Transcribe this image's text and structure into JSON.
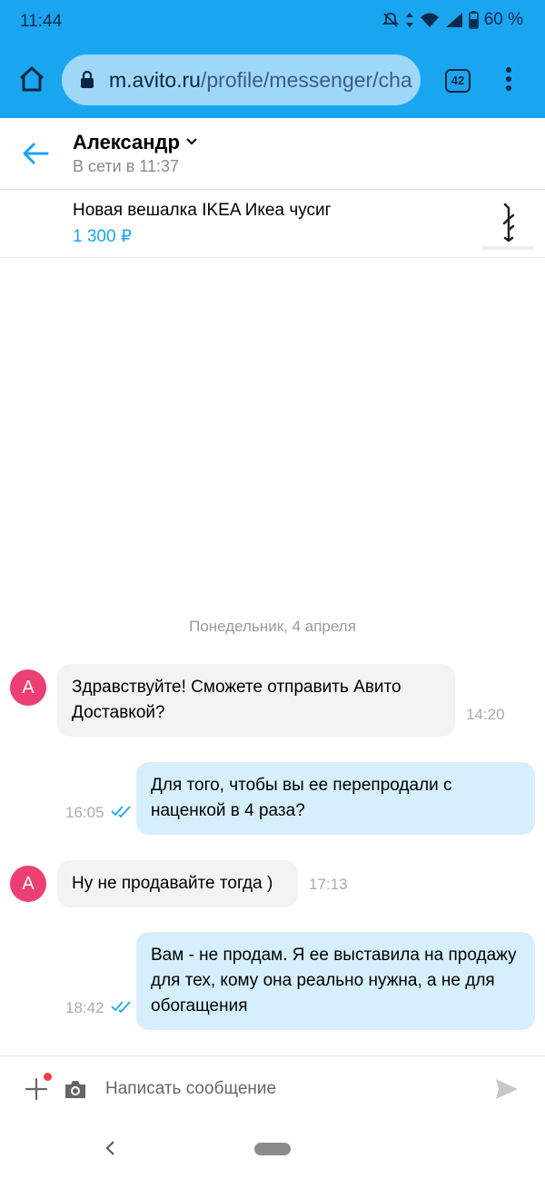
{
  "status_bar": {
    "time": "11:44",
    "battery": "60 %"
  },
  "browser": {
    "url_host": "m.avito.ru",
    "url_path": "/profile/messenger/cha",
    "tab_count": "42"
  },
  "chat": {
    "contact_name": "Александр",
    "contact_status": "В сети в 11:37",
    "avatar_letter": "А",
    "item": {
      "title": "Новая вешалка IKEA Икеа чусиг",
      "price": "1 300 ₽"
    },
    "date_separator": "Понедельник, 4 апреля",
    "messages": [
      {
        "direction": "in",
        "text": "Здравствуйте! Сможете отправить Авито Доставкой?",
        "time": "14:20"
      },
      {
        "direction": "out",
        "text": "Для того, чтобы вы ее перепродали с наценкой в 4 раза?",
        "time": "16:05"
      },
      {
        "direction": "in",
        "text": "Ну не продавайте тогда )",
        "time": "17:13"
      },
      {
        "direction": "out",
        "text": "Вам - не продам. Я ее выставила на продажу для тех, кому она реально нужна, а не для обогащения",
        "time": "18:42"
      }
    ]
  },
  "composer": {
    "placeholder": "Написать сообщение"
  },
  "icons": {
    "home": "home-icon",
    "lock": "lock-icon",
    "menu": "more-vert-icon",
    "back": "arrow-left-icon",
    "plus": "plus-icon",
    "camera": "camera-icon",
    "send": "send-icon",
    "read": "double-check-icon"
  },
  "colors": {
    "accent": "#1aa5f0",
    "avatar": "#ec3f73",
    "bubble_in": "#f3f3f3",
    "bubble_out": "#d6effc"
  }
}
